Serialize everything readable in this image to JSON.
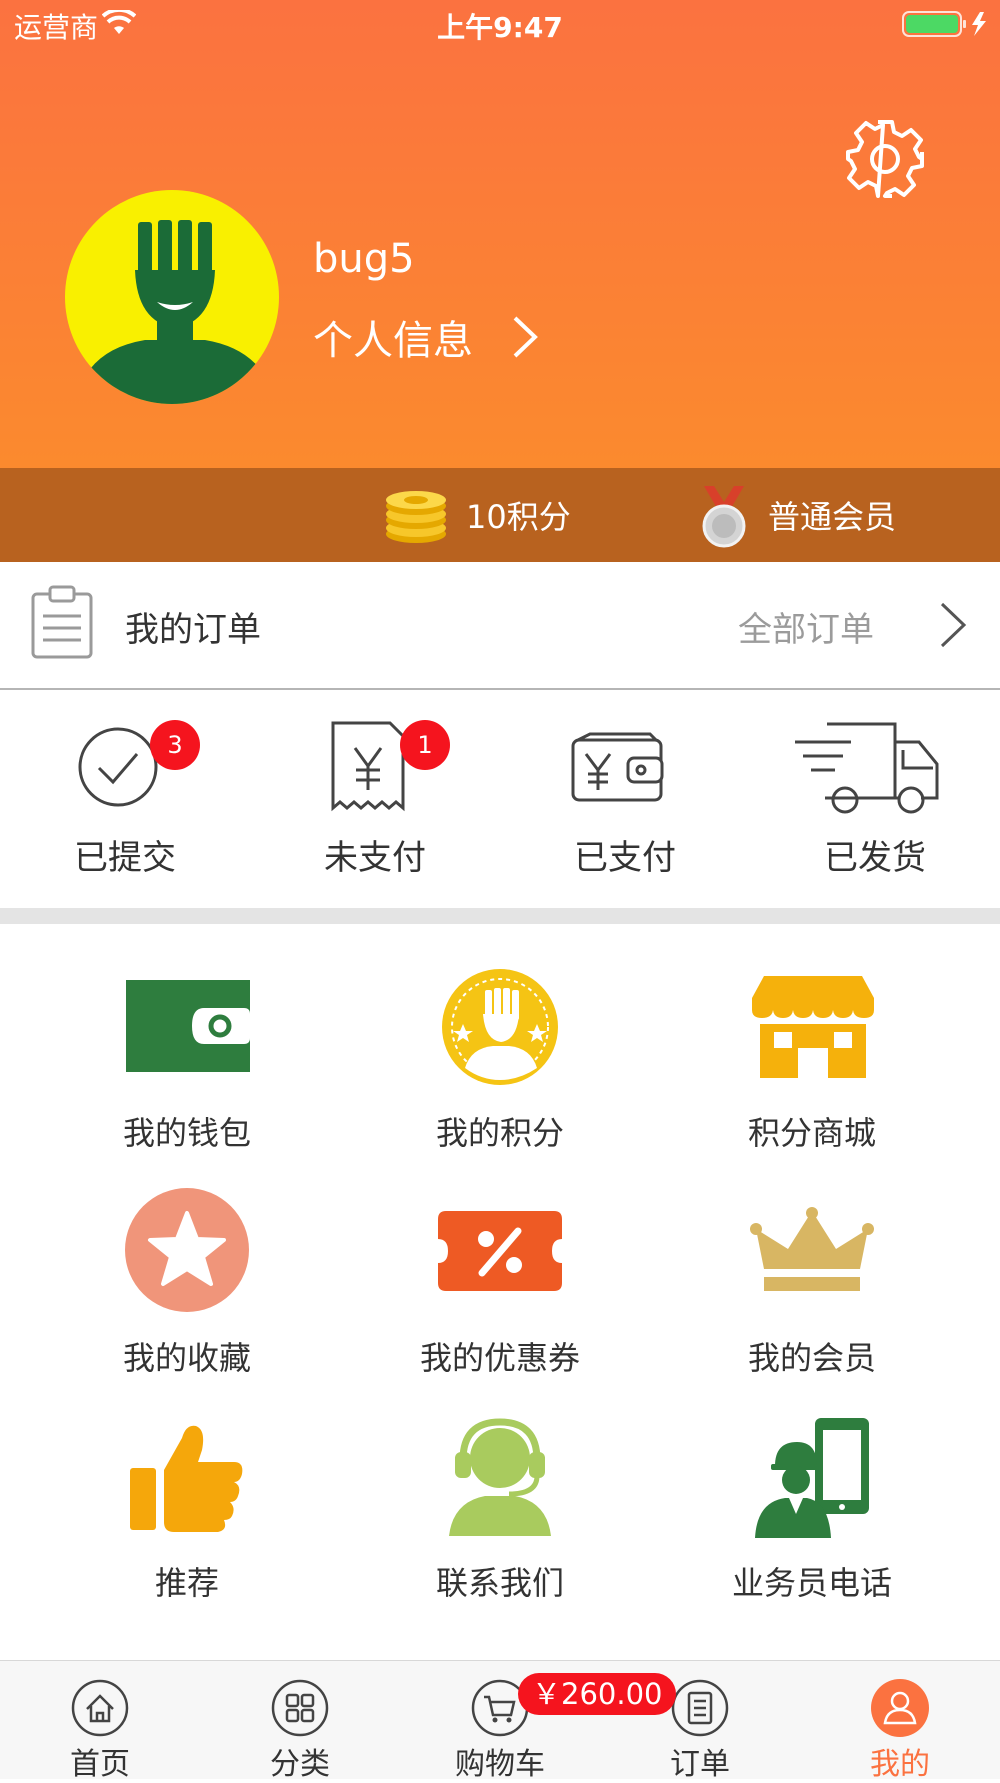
{
  "status_bar": {
    "carrier": "运营商",
    "time": "上午9:47"
  },
  "profile": {
    "username": "bug5",
    "info_link": "个人信息"
  },
  "member_bar": {
    "points": "10积分",
    "level": "普通会员"
  },
  "orders": {
    "title": "我的订单",
    "all_orders": "全部订单",
    "statuses": [
      {
        "label": "已提交",
        "badge": "3"
      },
      {
        "label": "未支付",
        "badge": "1"
      },
      {
        "label": "已支付"
      },
      {
        "label": "已发货"
      }
    ]
  },
  "grid": [
    {
      "label": "我的钱包",
      "icon": "wallet-icon"
    },
    {
      "label": "我的积分",
      "icon": "points-medal-icon"
    },
    {
      "label": "积分商城",
      "icon": "store-icon"
    },
    {
      "label": "我的收藏",
      "icon": "star-icon"
    },
    {
      "label": "我的优惠券",
      "icon": "coupon-icon"
    },
    {
      "label": "我的会员",
      "icon": "crown-icon"
    },
    {
      "label": "推荐",
      "icon": "thumbs-up-icon"
    },
    {
      "label": "联系我们",
      "icon": "headset-icon"
    },
    {
      "label": "业务员电话",
      "icon": "salesman-phone-icon"
    }
  ],
  "tabbar": {
    "tabs": [
      {
        "label": "首页",
        "icon": "home-icon"
      },
      {
        "label": "分类",
        "icon": "category-icon"
      },
      {
        "label": "购物车",
        "icon": "cart-icon"
      },
      {
        "label": "订单",
        "icon": "order-icon"
      },
      {
        "label": "我的",
        "icon": "user-icon",
        "active": true
      }
    ],
    "cart_total": "￥260.00"
  },
  "colors": {
    "header_top": "#fb7240",
    "header_bottom": "#fb8a2e",
    "member_bar": "#b8621f",
    "badge": "#f5141e",
    "active_tab": "#fb7240"
  }
}
